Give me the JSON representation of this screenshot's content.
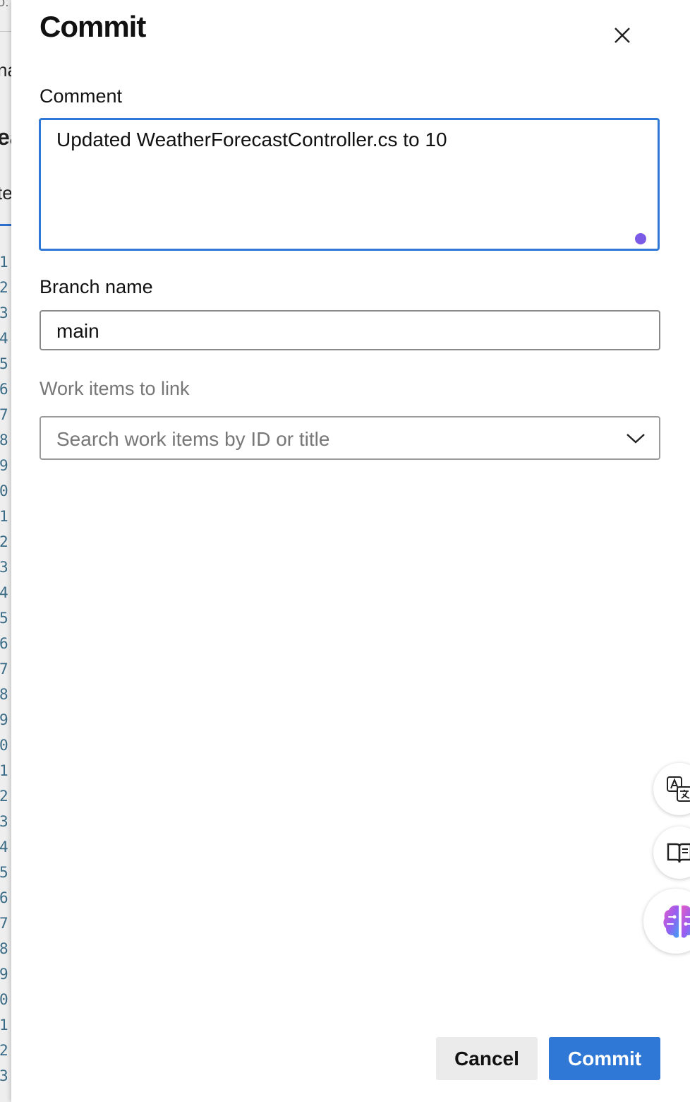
{
  "background": {
    "fragments": [
      "o:",
      "na",
      "ea",
      "te"
    ],
    "line_numbers": [
      "1",
      "2",
      "3",
      "4",
      "5",
      "6",
      "7",
      "8",
      "9",
      "0",
      "1",
      "2",
      "3",
      "4",
      "5",
      "6",
      "7",
      "8",
      "9",
      "0",
      "1",
      "2",
      "3",
      "4",
      "5",
      "6",
      "7",
      "8",
      "9",
      "0",
      "1",
      "2",
      "3"
    ]
  },
  "dialog": {
    "title": "Commit",
    "comment": {
      "label": "Comment",
      "value": "Updated WeatherForecastController.cs to 10"
    },
    "branch": {
      "label": "Branch name",
      "value": "main"
    },
    "work_items": {
      "label": "Work items to link",
      "placeholder": "Search work items by ID or title"
    },
    "buttons": {
      "cancel": "Cancel",
      "commit": "Commit"
    }
  },
  "floating_tools": [
    {
      "icon": "translate-icon"
    },
    {
      "icon": "reader-icon"
    },
    {
      "icon": "brain-icon"
    }
  ],
  "colors": {
    "accent": "#2f78d6",
    "resize_dot": "#7b5be6"
  }
}
